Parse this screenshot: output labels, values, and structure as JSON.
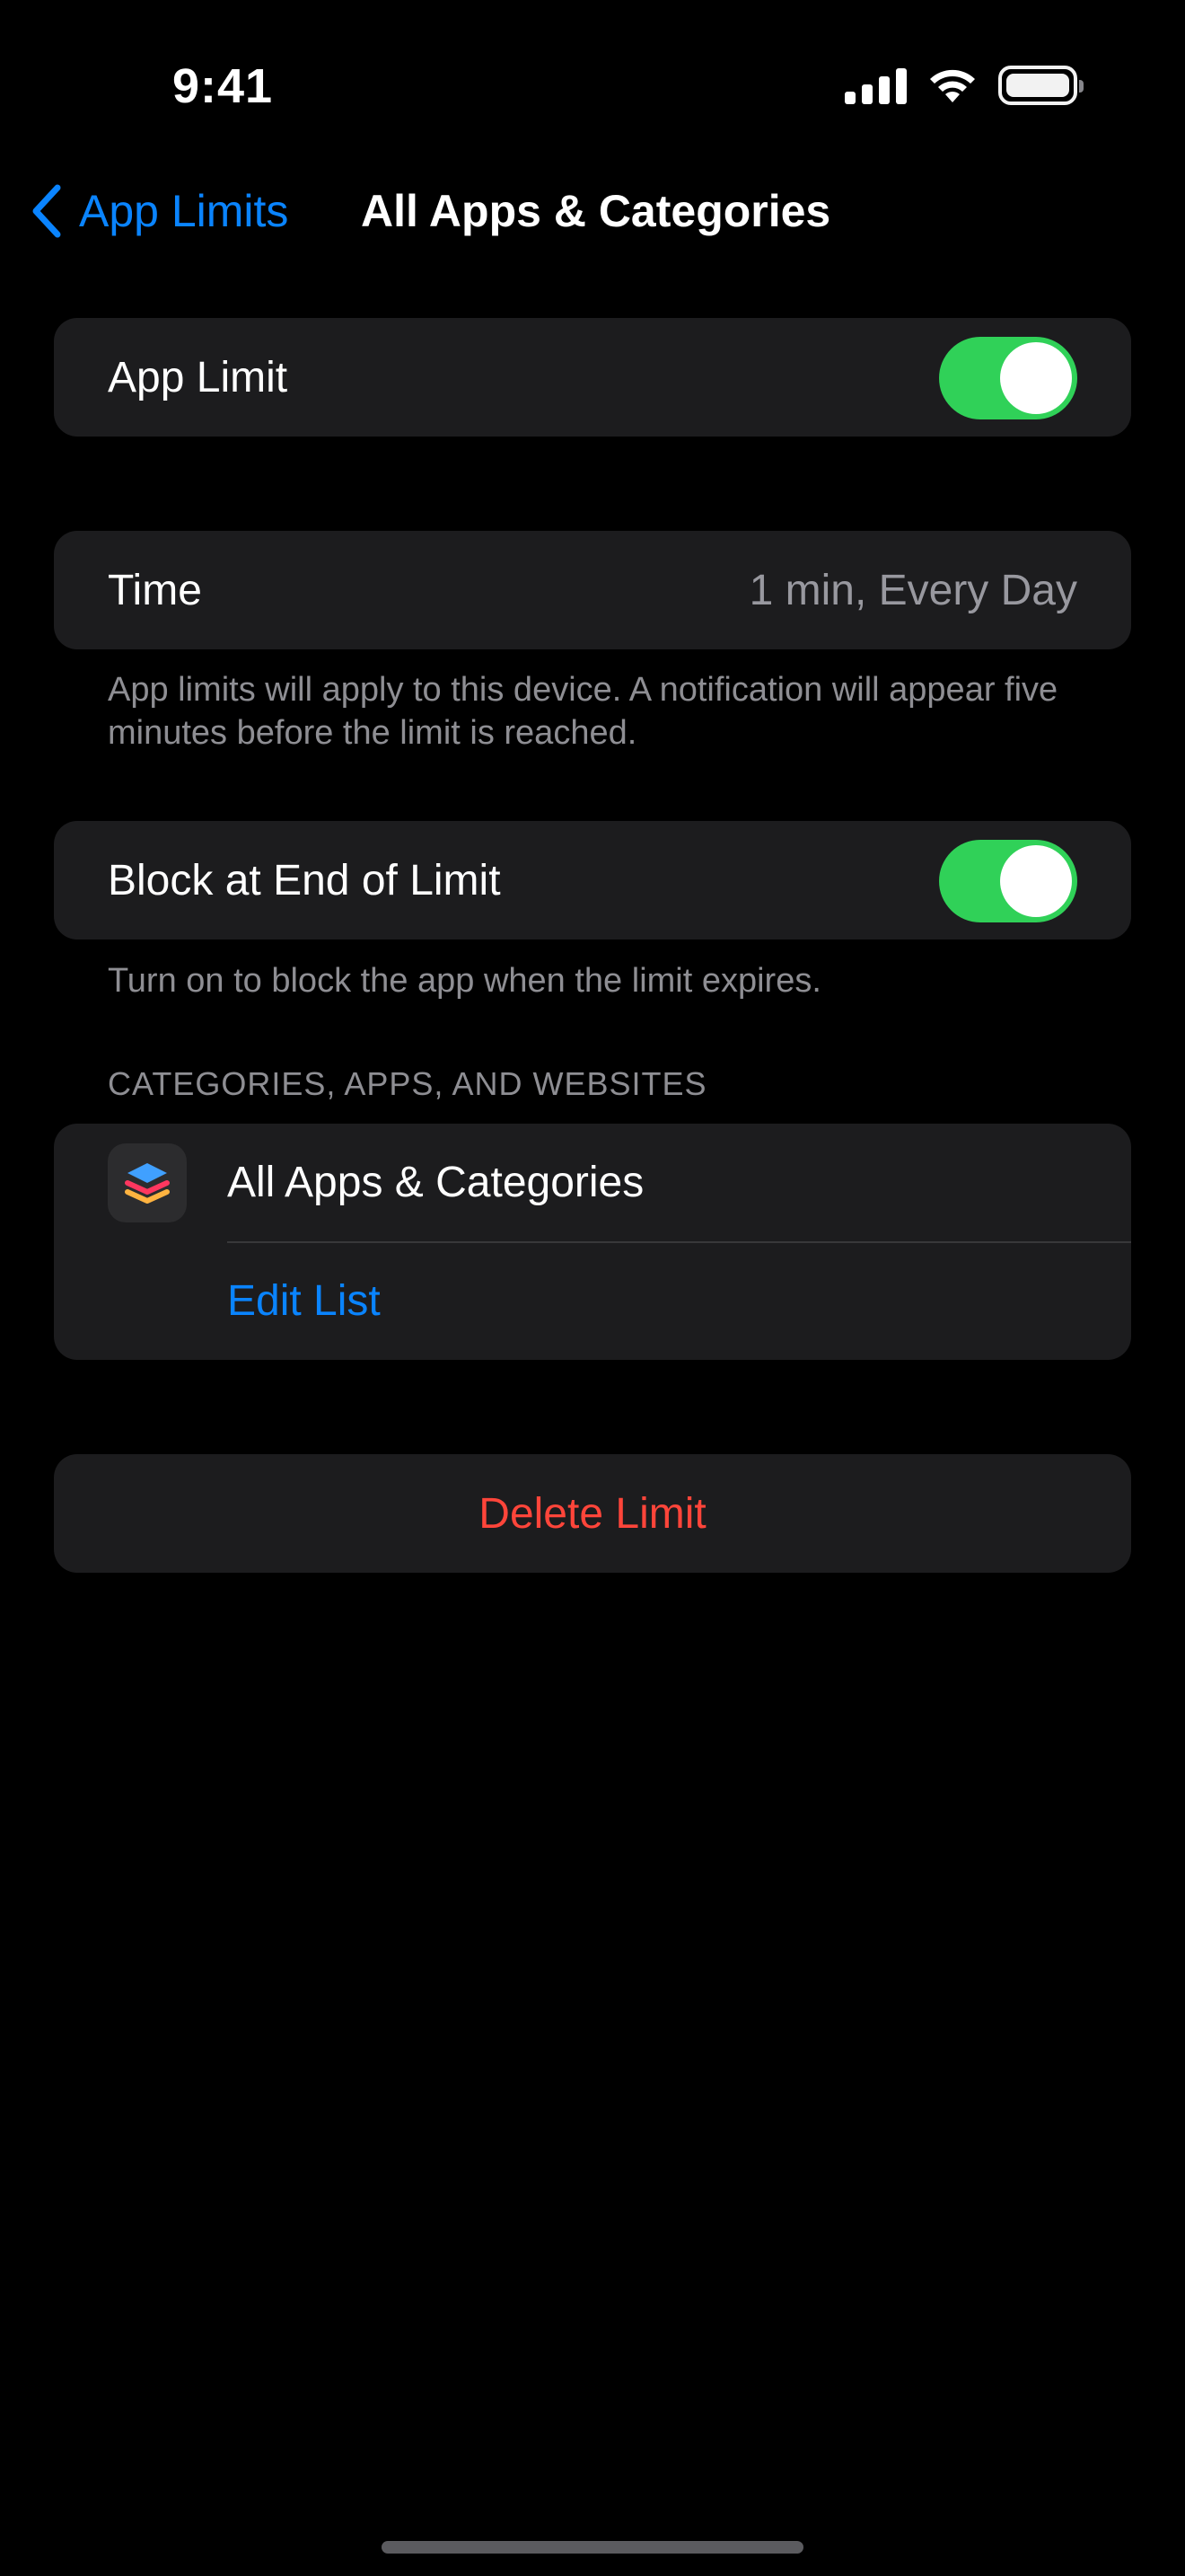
{
  "status_bar": {
    "time": "9:41"
  },
  "nav": {
    "back_label": "App Limits",
    "title": "All Apps & Categories",
    "accent_color": "#0a84ff"
  },
  "app_limit": {
    "label": "App Limit",
    "enabled": true
  },
  "time": {
    "label": "Time",
    "value": "1 min, Every Day",
    "footer": "App limits will apply to this device. A notification will appear five minutes before the limit is reached."
  },
  "block_at_end": {
    "label": "Block at End of Limit",
    "enabled": true,
    "footer": "Turn on to block the app when the limit expires."
  },
  "categories_section": {
    "header": "CATEGORIES, APPS, AND WEBSITES",
    "item_label": "All Apps & Categories",
    "item_icon": "stacked-layers-icon",
    "edit_label": "Edit List"
  },
  "delete": {
    "label": "Delete Limit",
    "color": "#ff453a"
  },
  "colors": {
    "toggle_on": "#30d158",
    "cell_background": "#1c1c1e",
    "secondary_text": "#8e8e93"
  }
}
